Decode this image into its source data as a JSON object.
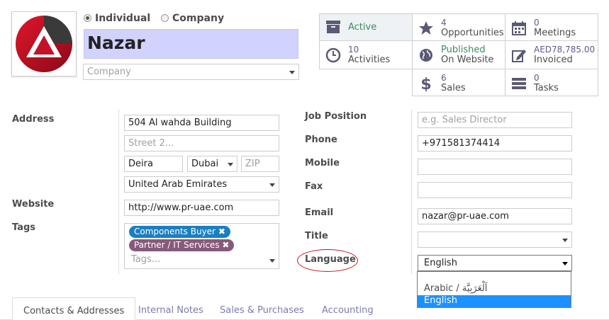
{
  "contact": {
    "type_options": [
      {
        "label": "Individual",
        "selected": true
      },
      {
        "label": "Company",
        "selected": false
      }
    ],
    "name": "Nazar",
    "company_placeholder": "Company"
  },
  "stats": {
    "active": {
      "label": "Active",
      "icon": "archive-icon"
    },
    "opportunities": {
      "count": "4",
      "label": "Opportunities",
      "icon": "star-icon"
    },
    "meetings": {
      "count": "0",
      "label": "Meetings",
      "icon": "calendar-icon"
    },
    "activities": {
      "count": "10",
      "label": "Activities",
      "icon": "clock-icon"
    },
    "website": {
      "line1": "Published",
      "line2": "On Website",
      "icon": "globe-icon"
    },
    "invoiced": {
      "amount": "AED78,785.00",
      "label": "Invoiced",
      "icon": "edit-icon"
    },
    "sales": {
      "count": "6",
      "label": "Sales",
      "icon": "dollar-icon"
    },
    "tasks": {
      "count": "0",
      "label": "Tasks",
      "icon": "tasks-icon"
    }
  },
  "left": {
    "address_label": "Address",
    "street": "504 Al wahda Building",
    "street2_placeholder": "Street 2...",
    "city": "Deira",
    "state": "Dubai",
    "zip_placeholder": "ZIP",
    "country": "United Arab Emirates",
    "website_label": "Website",
    "website": "http://www.pr-uae.com",
    "tags_label": "Tags",
    "tags": [
      {
        "label": "Components Buyer",
        "color": "#1a7fc1"
      },
      {
        "label": "Partner / IT Services",
        "color": "#875a7b"
      }
    ],
    "tags_placeholder": "Tags..."
  },
  "right": {
    "job_label": "Job Position",
    "job_placeholder": "e.g. Sales Director",
    "phone_label": "Phone",
    "phone": "+971581374414",
    "mobile_label": "Mobile",
    "fax_label": "Fax",
    "email_label": "Email",
    "email": "nazar@pr-uae.com",
    "title_label": "Title",
    "language_label": "Language",
    "language": "English",
    "language_options": [
      {
        "label": "Arabic / اَلْعَرَبِيَّة",
        "selected": false
      },
      {
        "label": "English",
        "selected": true
      }
    ]
  },
  "tabs": [
    "Contacts & Addresses",
    "Internal Notes",
    "Sales & Purchases",
    "Accounting"
  ],
  "colors": {
    "name_bg": "#d2d2ff",
    "link": "#7c7bad",
    "selected_option": "#1e90ff",
    "highlight_ellipse": "#c01818"
  }
}
